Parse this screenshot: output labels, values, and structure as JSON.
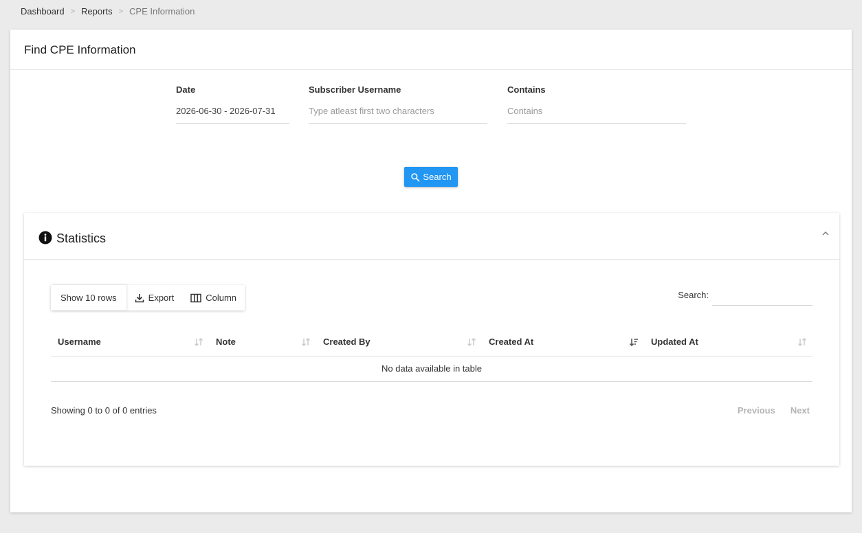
{
  "breadcrumb": {
    "items": [
      "Dashboard",
      "Reports"
    ],
    "current": "CPE Information"
  },
  "page": {
    "title": "Find CPE Information"
  },
  "filters": {
    "date": {
      "label": "Date",
      "value": "2026-06-30 - 2026-07-31"
    },
    "subscriber": {
      "label": "Subscriber Username",
      "placeholder": "Type atleast first two characters"
    },
    "contains": {
      "label": "Contains",
      "placeholder": "Contains"
    }
  },
  "search_button": {
    "label": "Search",
    "icon": "search-icon"
  },
  "statistics": {
    "title": "Statistics",
    "icon": "info-icon",
    "toolbar": {
      "rows_label": "Show 10 rows",
      "export_label": "Export",
      "column_label": "Column"
    },
    "search_label": "Search:",
    "columns": [
      "Username",
      "Note",
      "Created By",
      "Created At",
      "Updated At"
    ],
    "empty_message": "No data available in table",
    "info": "Showing 0 to 0 of 0 entries",
    "pagination": {
      "previous": "Previous",
      "next": "Next"
    }
  },
  "colors": {
    "accent": "#2196f3",
    "background": "#ebebeb"
  }
}
